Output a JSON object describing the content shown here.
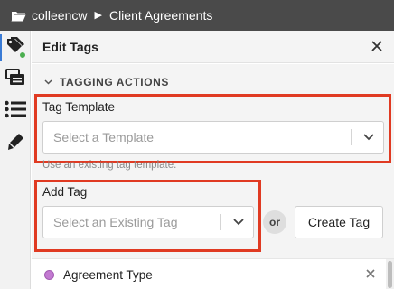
{
  "breadcrumb": {
    "user": "colleencw",
    "separator": "▶",
    "folder": "Client Agreements"
  },
  "rail": {
    "items": [
      "tag-icon",
      "stack-icon",
      "list-icon",
      "pen-icon"
    ],
    "badge_color": "#4caf50"
  },
  "panel": {
    "title": "Edit Tags",
    "section_title": "TAGGING ACTIONS",
    "tag_template": {
      "label": "Tag Template",
      "placeholder": "Select a Template",
      "hint": "Use an existing tag template."
    },
    "add_tag": {
      "label": "Add Tag",
      "placeholder": "Select an Existing Tag",
      "or_label": "or",
      "create_button": "Create Tag"
    },
    "tags": [
      {
        "label": "Agreement Type",
        "color": "#c27ad1"
      }
    ]
  },
  "colors": {
    "highlight": "#e03a22",
    "topbar": "#4a4a4a",
    "accent": "#3a7bd5"
  }
}
